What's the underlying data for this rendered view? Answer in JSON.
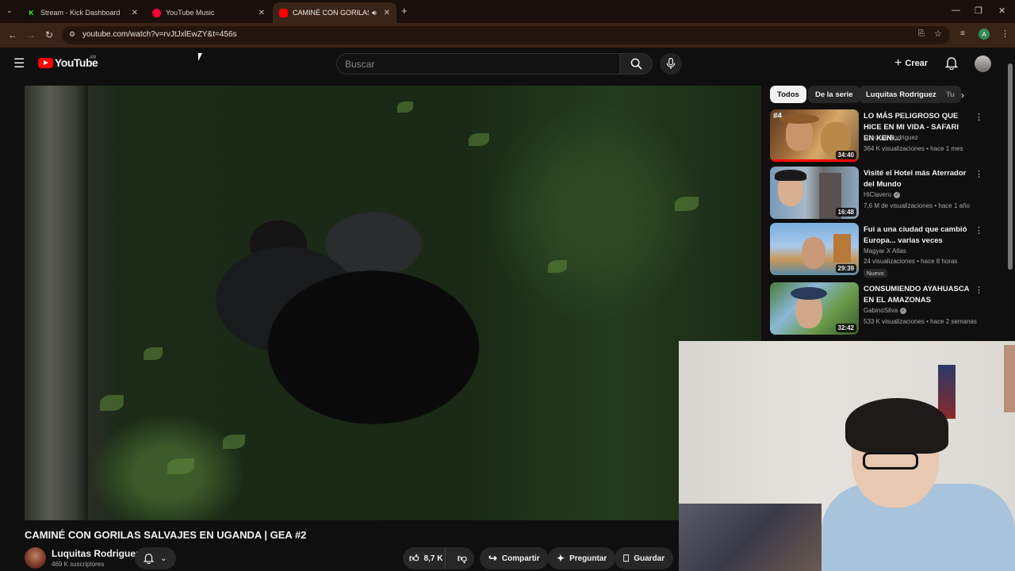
{
  "browser": {
    "tabs": [
      {
        "label": "Stream - Kick Dashboard",
        "fav": "K",
        "fav_color": "#53fc18"
      },
      {
        "label": "YouTube Music",
        "fav": "",
        "fav_color": "#ff0033"
      },
      {
        "label": "CAMINÉ CON GORILAS SAL",
        "fav": "",
        "fav_color": "#ff0000",
        "active": true
      }
    ],
    "url": "youtube.com/watch?v=rvJtJxlEwZY&t=456s",
    "profile_initial": "A"
  },
  "youtube": {
    "logo_text": "YouTube",
    "country": "AR",
    "search_placeholder": "Buscar",
    "create_label": "Crear"
  },
  "video": {
    "title": "CAMINÉ CON GORILAS SALVAJES EN UGANDA | GEA #2",
    "channel": "Luquitas Rodriguez",
    "subscribers": "469 K suscriptores",
    "likes": "8,7 K",
    "share_label": "Compartir",
    "ask_label": "Preguntar",
    "save_label": "Guardar"
  },
  "chips": [
    "Todos",
    "De la serie",
    "Luquitas Rodriguez",
    "Tu"
  ],
  "recommendations": [
    {
      "title": "LO MÁS PELIGROSO QUE HICE EN MI VIDA - SAFARI EN KENI...",
      "channel": "Luquitas Rodriguez",
      "meta": "364 K visualizaciones • hace 1 mes",
      "duration": "34:40",
      "verified": false,
      "new": false,
      "thumb_overlay": "#4"
    },
    {
      "title": "Visité el Hotel más Aterrador del Mundo",
      "channel": "HiClavero",
      "meta": "7,6 M de visualizaciones • hace 1 año",
      "duration": "16:48",
      "verified": true,
      "new": false
    },
    {
      "title": "Fui a una ciudad que cambió Europa... varias veces",
      "channel": "Magyar X Atlas",
      "meta": "24 visualizaciones • hace 8 horas",
      "duration": "29:39",
      "verified": false,
      "new": true,
      "new_label": "Nuevo"
    },
    {
      "title": "CONSUMIENDO AYAHUASCA EN EL AMAZONAS",
      "channel": "GabinoSilva",
      "meta": "533 K visualizaciones • hace 2 semanas",
      "duration": "32:42",
      "verified": true,
      "new": false
    }
  ]
}
